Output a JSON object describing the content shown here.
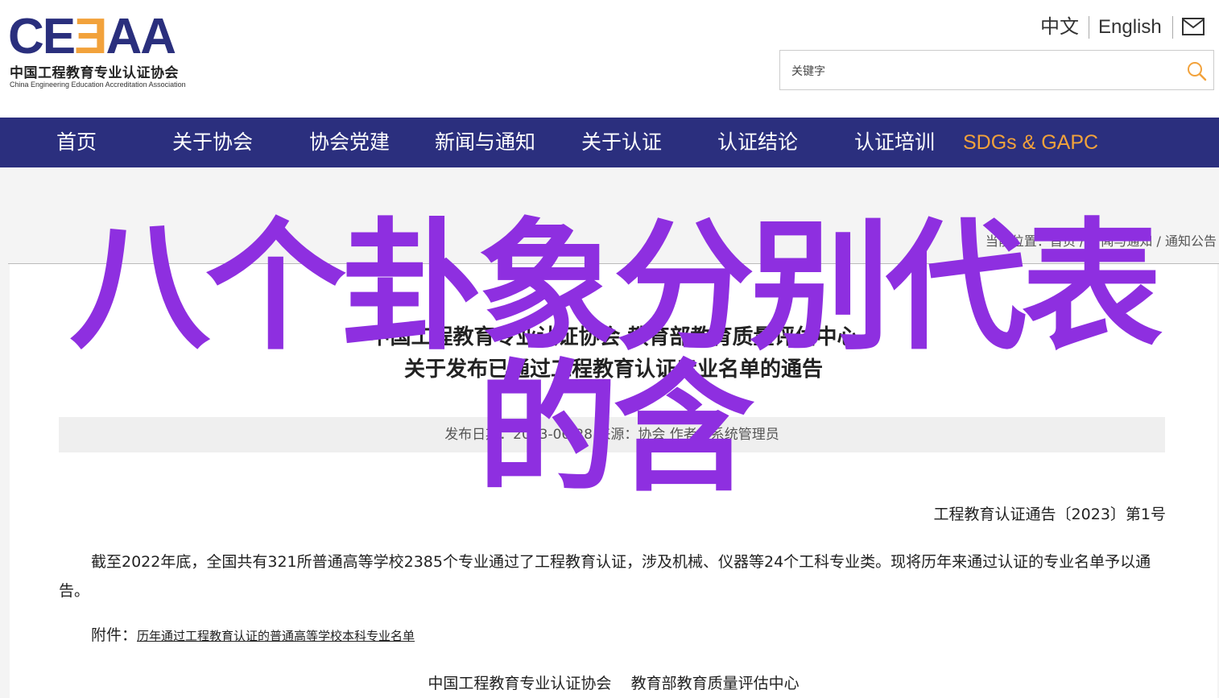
{
  "header": {
    "logo": {
      "mark_part1": "CE",
      "mark_part2": "Ǝ",
      "mark_part3": "AA",
      "name_cn": "中国工程教育专业认证协会",
      "name_en": "China Engineering Education Accreditation Association"
    },
    "lang_cn": "中文",
    "lang_en": "English",
    "search_placeholder": "关键字"
  },
  "nav": {
    "items": [
      {
        "label": "首页"
      },
      {
        "label": "关于协会"
      },
      {
        "label": "协会党建"
      },
      {
        "label": "新闻与通知"
      },
      {
        "label": "关于认证"
      },
      {
        "label": "认证结论"
      },
      {
        "label": "认证培训"
      },
      {
        "label": "SDGs & GAPC"
      }
    ]
  },
  "breadcrumb": {
    "prefix": "当前位置：",
    "items": [
      "首页",
      "新闻与通知",
      "通知公告"
    ]
  },
  "article": {
    "title_line1": "中国工程教育专业认证协会 教育部教育质量评估中心",
    "title_line2": "关于发布已通过工程教育认证专业名单的通告",
    "meta": "发布日期：2023-06-28    来源：协会    作者：系统管理员",
    "notice_number": "工程教育认证通告〔2023〕第1号",
    "paragraph": "截至2022年底，全国共有321所普通高等学校2385个专业通过了工程教育认证，涉及机械、仪器等24个工科专业类。现将历年来通过认证的专业名单予以通告。",
    "attachment_label": "附件：",
    "attachment_link": "历年通过工程教育认证的普通高等学校本科专业名单",
    "signature": "中国工程教育专业认证协会    教育部教育质量评估中心"
  },
  "watermark": {
    "text": "八个卦象分别代表的含"
  },
  "colors": {
    "nav_bg": "#2b2f7e",
    "accent_orange": "#f2a23b",
    "watermark_purple": "#8e2fe0"
  }
}
